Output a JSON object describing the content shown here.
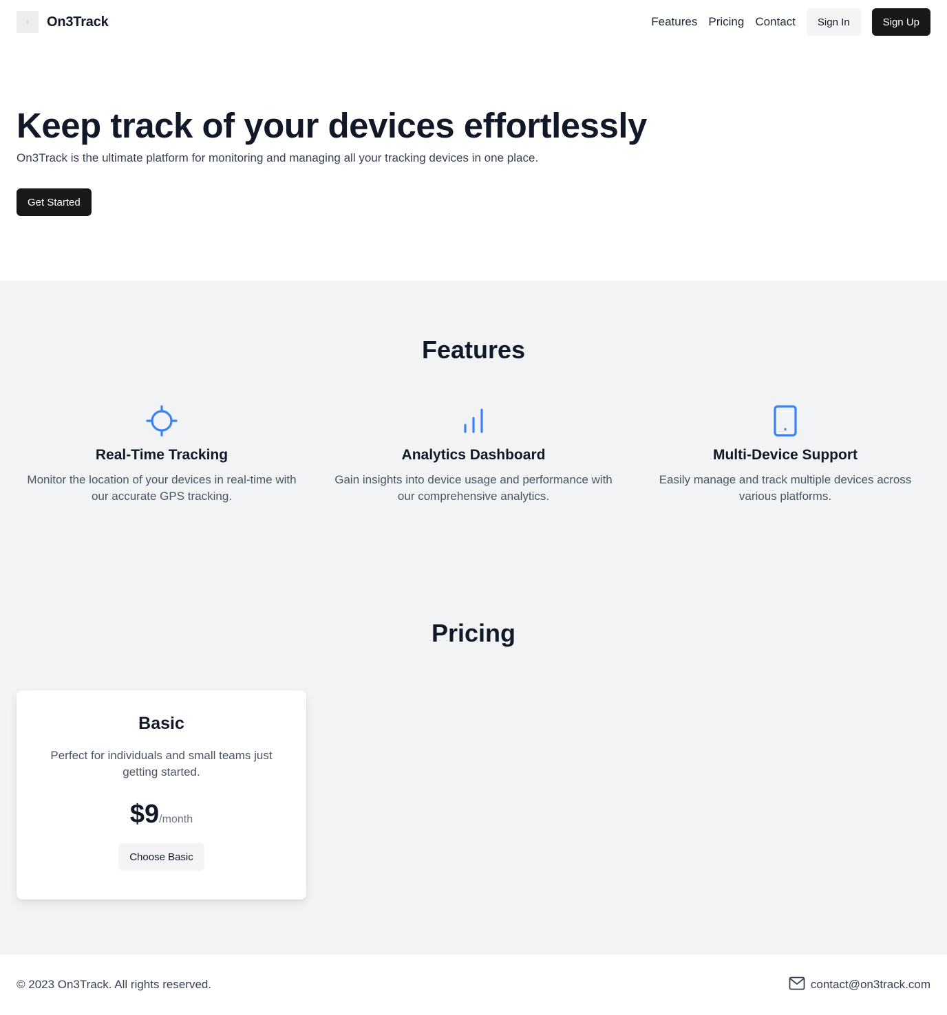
{
  "header": {
    "brand": "On3Track",
    "nav": [
      "Features",
      "Pricing",
      "Contact"
    ],
    "sign_in": "Sign In",
    "sign_up": "Sign Up"
  },
  "hero": {
    "title": "Keep track of your devices effortlessly",
    "subtitle": "On3Track is the ultimate platform for monitoring and managing all your tracking devices in one place.",
    "cta": "Get Started"
  },
  "features": {
    "title": "Features",
    "items": [
      {
        "icon": "crosshair-icon",
        "title": "Real-Time Tracking",
        "desc": "Monitor the location of your devices in real-time with our accurate GPS tracking."
      },
      {
        "icon": "bar-chart-icon",
        "title": "Analytics Dashboard",
        "desc": "Gain insights into device usage and performance with our comprehensive analytics."
      },
      {
        "icon": "smartphone-icon",
        "title": "Multi-Device Support",
        "desc": "Easily manage and track multiple devices across various platforms."
      }
    ]
  },
  "pricing": {
    "title": "Pricing",
    "plans": [
      {
        "name": "Basic",
        "desc": "Perfect for individuals and small teams just getting started.",
        "amount": "$9",
        "period": "/month",
        "cta": "Choose Basic"
      }
    ]
  },
  "footer": {
    "copyright": "© 2023 On3Track. All rights reserved.",
    "email": "contact@on3track.com",
    "email_icon": "mail-icon"
  },
  "colors": {
    "accent": "#3b82f6",
    "primary_button": "#18181b",
    "section_bg": "#f2f3f5"
  }
}
